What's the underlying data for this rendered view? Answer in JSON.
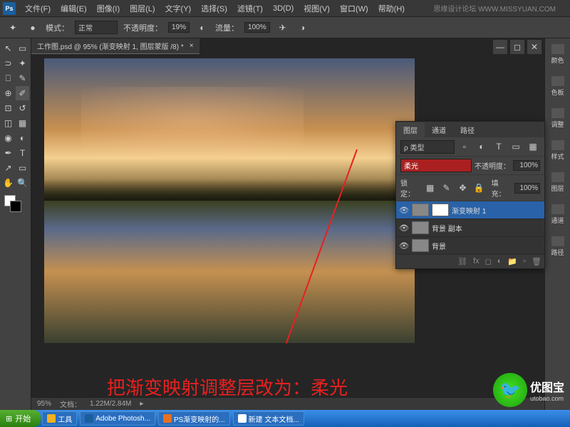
{
  "app": {
    "name": "Ps",
    "watermark": "思缘设计论坛  WWW.MISSYUAN.COM"
  },
  "menu": {
    "file": "文件(F)",
    "edit": "编辑(E)",
    "image": "图像(I)",
    "layer": "图层(L)",
    "type": "文字(Y)",
    "select": "选择(S)",
    "filter": "滤镜(T)",
    "d3": "3D(D)",
    "view": "视图(V)",
    "window": "窗口(W)",
    "help": "帮助(H)"
  },
  "options": {
    "mode_label": "模式：",
    "mode_value": "正常",
    "opacity_label": "不透明度：",
    "opacity_value": "19%",
    "flow_label": "流量：",
    "flow_value": "100%"
  },
  "document": {
    "title": "工作图.psd @ 95% (渐变映射 1, 图层蒙版 /8) *",
    "zoom": "95%",
    "size_label": "文档：",
    "size": "1.22M/2.84M"
  },
  "right_tabs": {
    "color": "颜色",
    "swatch": "色板",
    "adjust": "调整",
    "style": "样式",
    "layers": "图层",
    "channel": "通道",
    "path": "路径"
  },
  "layers_panel": {
    "tab_layers": "图层",
    "tab_channels": "通道",
    "tab_paths": "路径",
    "kind_label": "ρ 类型",
    "blend_value": "柔光",
    "opacity_label": "不透明度：",
    "opacity_value": "100%",
    "lock_label": "锁定：",
    "fill_label": "填充：",
    "fill_value": "100%",
    "layers": [
      {
        "name": "渐变映射 1",
        "selected": true,
        "has_mask": true
      },
      {
        "name": "背景 副本",
        "selected": false,
        "has_mask": false
      },
      {
        "name": "背景",
        "selected": false,
        "has_mask": false
      }
    ],
    "footer_fx": "fx"
  },
  "annotation": {
    "text": "把渐变映射调整层改为：柔光"
  },
  "taskbar": {
    "start": "开始",
    "items": [
      {
        "label": "工具"
      },
      {
        "label": "Adobe Photosh..."
      },
      {
        "label": "PS渐变映射的..."
      },
      {
        "label": "新建 文本文档..."
      }
    ]
  },
  "ubao": {
    "brand": "优图宝",
    "url": "utobao.com"
  }
}
